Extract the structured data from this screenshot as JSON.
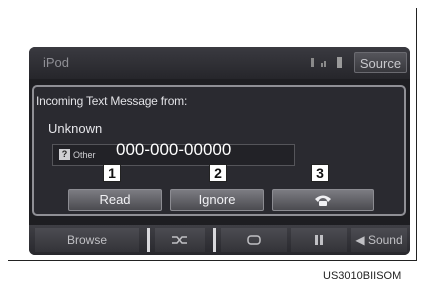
{
  "app_title": "iPod",
  "source_button": "Source",
  "popup": {
    "heading": "Incoming Text Message from:",
    "sender": "Unknown",
    "phone_type_label": "Other",
    "phone_type_icon": "phone-type-icon",
    "phone_number": "000-000-00000"
  },
  "buttons": {
    "read": "Read",
    "ignore": "Ignore",
    "call_icon": "phone-handset-icon"
  },
  "callouts": [
    "1",
    "2",
    "3"
  ],
  "bottom_bar": {
    "browse": "Browse",
    "shuffle_icon": "shuffle-icon",
    "repeat_icon": "repeat-icon",
    "pause_icon": "pause-icon",
    "sound": "Sound"
  },
  "figure_code": "US3010BIISOM"
}
